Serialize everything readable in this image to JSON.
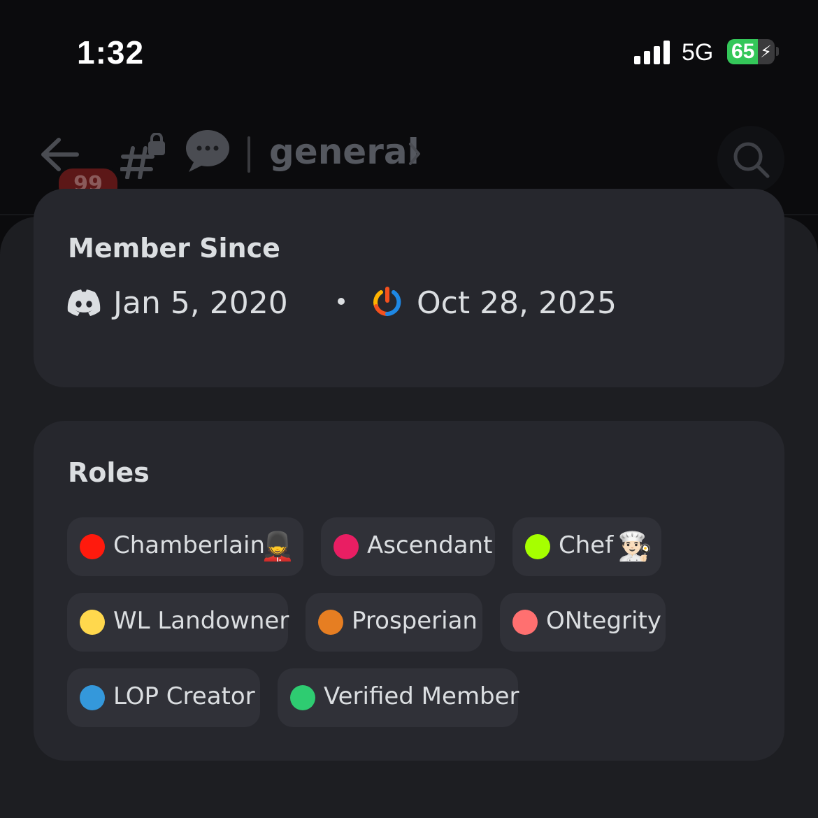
{
  "status_bar": {
    "time": "1:32",
    "network": "5G",
    "battery_percent": "65",
    "battery_level": 0.65,
    "charging_icon": "bolt-icon"
  },
  "header": {
    "back_icon": "back-arrow-icon",
    "unread_badge": "99",
    "channel_icon": "locked-hash-icon",
    "thread_icon": "speech-bubble-icon",
    "channel_name": "general",
    "chevron_icon": "chevron-right-icon",
    "search_icon": "search-icon"
  },
  "member_since": {
    "title": "Member Since",
    "discord_icon": "discord-logo-icon",
    "discord_date": "Jan 5, 2020",
    "separator": "•",
    "server_icon": "server-power-icon",
    "server_date": "Oct 28, 2025"
  },
  "roles": {
    "title": "Roles",
    "items": [
      {
        "label": "Chamberlain",
        "color": "#ff1a0d",
        "emoji": "💂"
      },
      {
        "label": "Ascendant",
        "color": "#e91e63",
        "emoji": ""
      },
      {
        "label": "Chef",
        "color": "#a6ff00",
        "emoji": "👨🏻‍🍳"
      },
      {
        "label": "WL Landowner",
        "color": "#ffd84d",
        "emoji": ""
      },
      {
        "label": "Prosperian",
        "color": "#e67e22",
        "emoji": ""
      },
      {
        "label": "ONtegrity",
        "color": "#ff7070",
        "emoji": ""
      },
      {
        "label": "LOP Creator",
        "color": "#3498db",
        "emoji": ""
      },
      {
        "label": "Verified Member",
        "color": "#2ecc71",
        "emoji": ""
      }
    ]
  }
}
